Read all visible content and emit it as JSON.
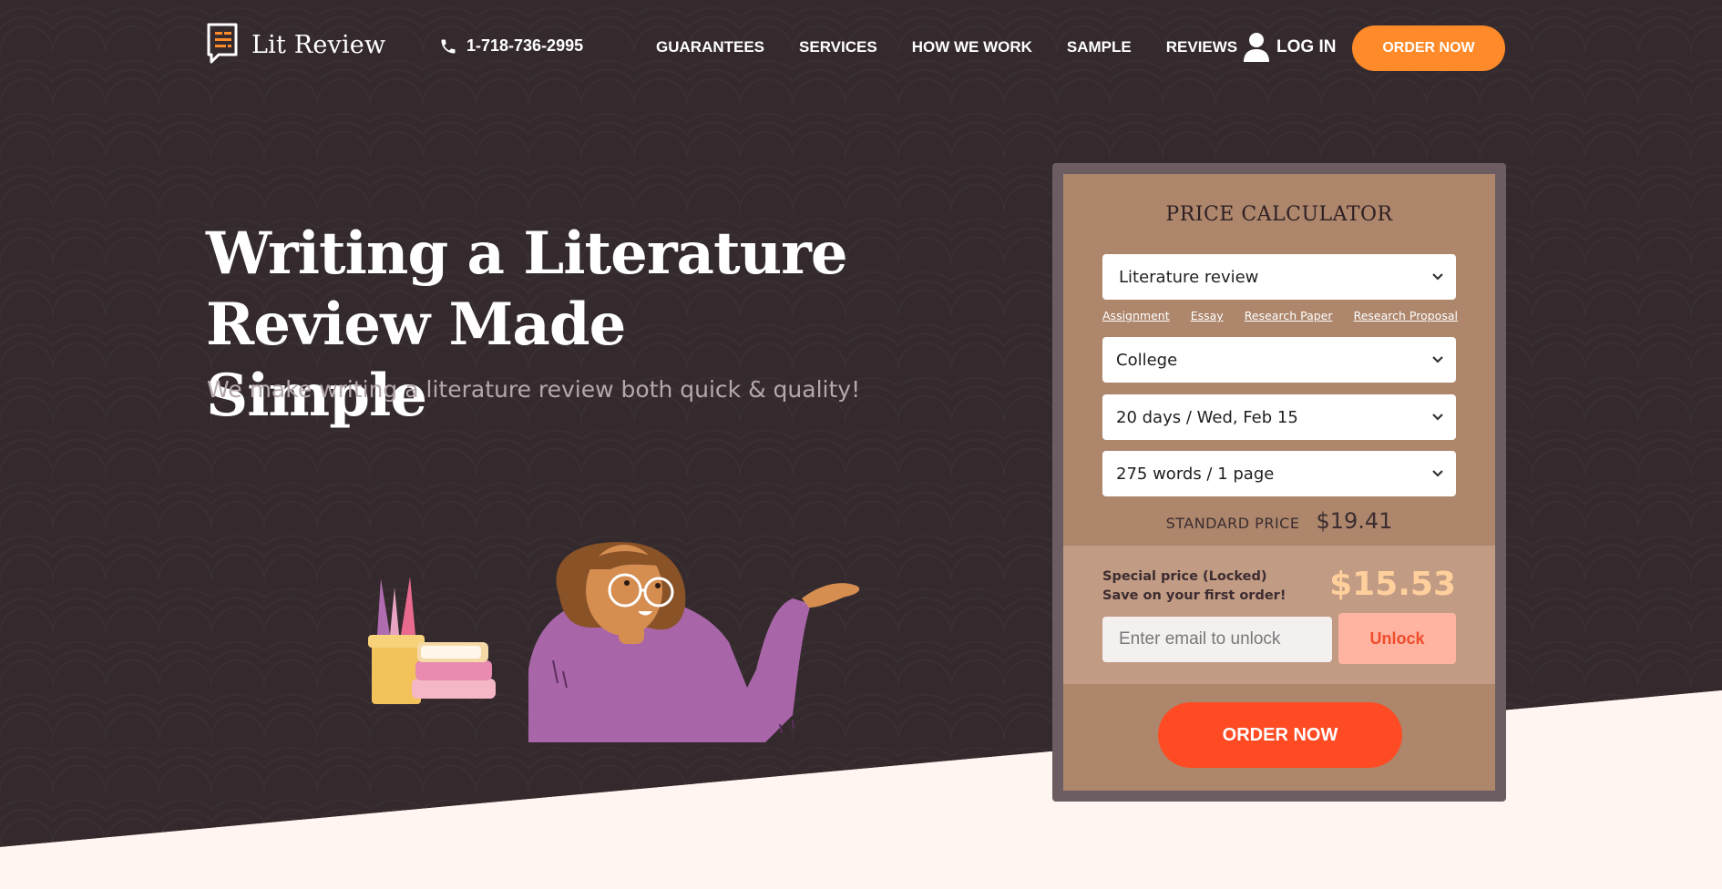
{
  "header": {
    "logo_text": "Lit Review",
    "phone": "1-718-736-2995",
    "nav": [
      "GUARANTEES",
      "SERVICES",
      "HOW WE WORK",
      "SAMPLE",
      "REVIEWS"
    ],
    "login_label": "LOG IN",
    "order_label": "ORDER NOW"
  },
  "hero": {
    "title_line1": "Writing a Literature",
    "title_line2": "Review Made Simple",
    "subtitle": "We make writing a literature review both quick & quality!"
  },
  "calculator": {
    "title": "PRICE CALCULATOR",
    "paper_type": "Literature review",
    "quick_links": [
      "Assignment",
      "Essay",
      "Research Paper",
      "Research Proposal"
    ],
    "academic_level": "College",
    "deadline": "20 days / Wed, Feb 15",
    "pages": "275 words / 1 page",
    "standard_label": "STANDARD PRICE",
    "standard_price": "$19.41",
    "special_line1": "Special price (Locked)",
    "special_line2": "Save on your first order!",
    "special_price": "$15.53",
    "email_placeholder": "Enter email to unlock",
    "unlock_label": "Unlock",
    "order_label": "ORDER NOW"
  },
  "colors": {
    "hero_bg": "#342a2d",
    "accent_orange": "#ff8a2a",
    "order_red": "#ff4b24",
    "calc_bg": "#ad866b",
    "special_price": "#ffcf9c"
  },
  "icons": [
    "logo-icon",
    "phone-icon",
    "user-icon",
    "chevron-down-icon"
  ]
}
